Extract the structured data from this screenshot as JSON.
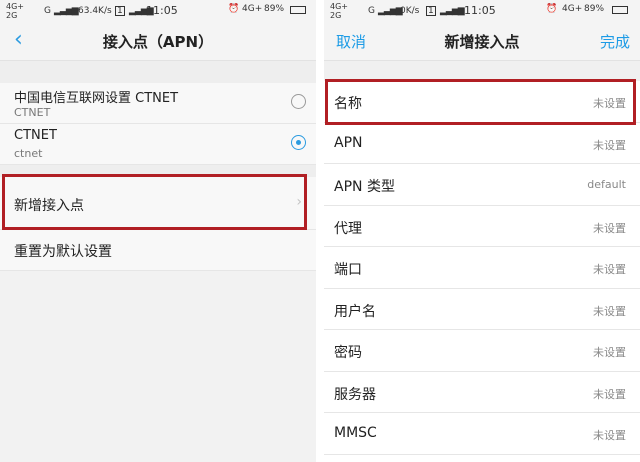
{
  "left": {
    "status": {
      "net_top": "4G+",
      "net_bottom": "2G",
      "signal": "G",
      "speed": "63.4K/s",
      "sim": "1",
      "time": "11:05",
      "alarm": "⏰",
      "net_right": "4G+",
      "battery": "89%"
    },
    "title": "接入点（APN）",
    "apns": [
      {
        "name": "中国电信互联网设置 CTNET",
        "apn": "CTNET",
        "selected": false
      },
      {
        "name": "CTNET",
        "apn": "ctnet",
        "selected": true
      }
    ],
    "actions": [
      {
        "label": "新增接入点"
      },
      {
        "label": "重置为默认设置"
      }
    ]
  },
  "right": {
    "status": {
      "net_top": "4G+",
      "net_bottom": "2G",
      "signal": "G",
      "speed": "0K/s",
      "sim": "1",
      "time": "11:05",
      "alarm": "⏰",
      "net_right": "4G+",
      "battery": "89%"
    },
    "cancel": "取消",
    "title": "新增接入点",
    "done": "完成",
    "fields": [
      {
        "name": "名称",
        "value": "未设置"
      },
      {
        "name": "APN",
        "value": "未设置"
      },
      {
        "name": "APN 类型",
        "value": "default"
      },
      {
        "name": "代理",
        "value": "未设置"
      },
      {
        "name": "端口",
        "value": "未设置"
      },
      {
        "name": "用户名",
        "value": "未设置"
      },
      {
        "name": "密码",
        "value": "未设置"
      },
      {
        "name": "服务器",
        "value": "未设置"
      },
      {
        "name": "MMSC",
        "value": "未设置"
      }
    ]
  },
  "colors": {
    "accent": "#1c9be6",
    "highlight": "#b11f24"
  }
}
